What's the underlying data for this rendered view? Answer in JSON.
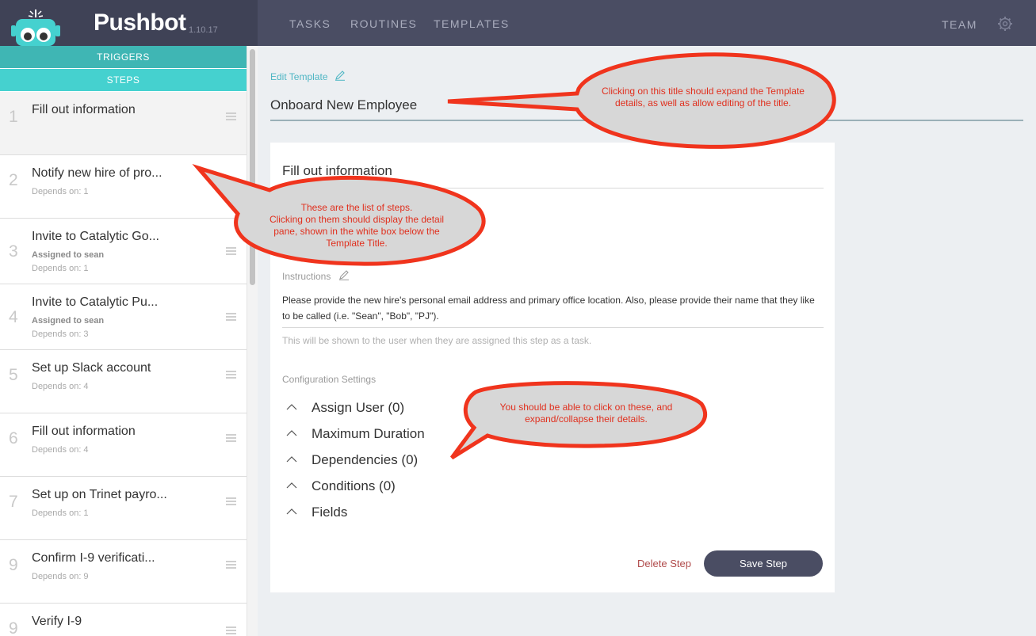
{
  "app": {
    "name": "Pushbot",
    "version": "1.10.17"
  },
  "nav": {
    "tasks": "TASKS",
    "routines": "ROUTINES",
    "templates": "TEMPLATES",
    "team": "TEAM"
  },
  "sidebar": {
    "triggers_tab": "TRIGGERS",
    "steps_tab": "STEPS",
    "steps": [
      {
        "num": "1",
        "title": "Fill out information",
        "assigned": "",
        "depends": ""
      },
      {
        "num": "2",
        "title": "Notify new hire of pro...",
        "assigned": "",
        "depends": "Depends on: 1"
      },
      {
        "num": "3",
        "title": "Invite to Catalytic Go...",
        "assigned": "Assigned to sean",
        "depends": "Depends on: 1"
      },
      {
        "num": "4",
        "title": "Invite to Catalytic Pu...",
        "assigned": "Assigned to sean",
        "depends": "Depends on: 3"
      },
      {
        "num": "5",
        "title": "Set up Slack account",
        "assigned": "",
        "depends": "Depends on: 4"
      },
      {
        "num": "6",
        "title": "Fill out information",
        "assigned": "",
        "depends": "Depends on: 4"
      },
      {
        "num": "7",
        "title": "Set up on Trinet payro...",
        "assigned": "",
        "depends": "Depends on: 1"
      },
      {
        "num": "9",
        "title": "Confirm I-9 verificati...",
        "assigned": "",
        "depends": "Depends on: 9"
      },
      {
        "num": "9",
        "title": "Verify I-9",
        "assigned": "",
        "depends": ""
      }
    ]
  },
  "main": {
    "edit_template_label": "Edit Template",
    "template_title": "Onboard New Employee",
    "card": {
      "step_title": "Fill out information",
      "instructions_label": "Instructions",
      "instructions_text": "Please provide the new hire's personal email address and primary office location. Also, please provide their name that they like to be called (i.e. \"Sean\", \"Bob\", \"PJ\").",
      "instructions_help": "This will be shown to the user when they are assigned this step as a task.",
      "config_label": "Configuration Settings",
      "config_items": [
        "Assign User (0)",
        "Maximum Duration",
        "Dependencies (0)",
        "Conditions (0)",
        "Fields"
      ],
      "delete_label": "Delete Step",
      "save_label": "Save Step"
    }
  },
  "annotations": {
    "title_note_line1": "Clicking on this title should expand the Template",
    "title_note_line2": "details, as well as allow editing of the title.",
    "steps_note_line1": "These are the list of steps.",
    "steps_note_line2": "Clicking on them should display the detail",
    "steps_note_line3": "pane, shown in the white box below the",
    "steps_note_line4": "Template Title.",
    "config_note_line1": "You should be able to click on these, and",
    "config_note_line2": "expand/collapse their details."
  },
  "colors": {
    "topbar": "#4a4d63",
    "accent_teal": "#45d1cf",
    "annotation_red": "#e0301e",
    "save_button": "#4a4d63"
  },
  "icons": {
    "logo": "robot-logo-icon",
    "settings": "gear-icon",
    "edit": "pencil-icon",
    "drag": "drag-handle-icon",
    "expand": "chevron-up-icon"
  }
}
